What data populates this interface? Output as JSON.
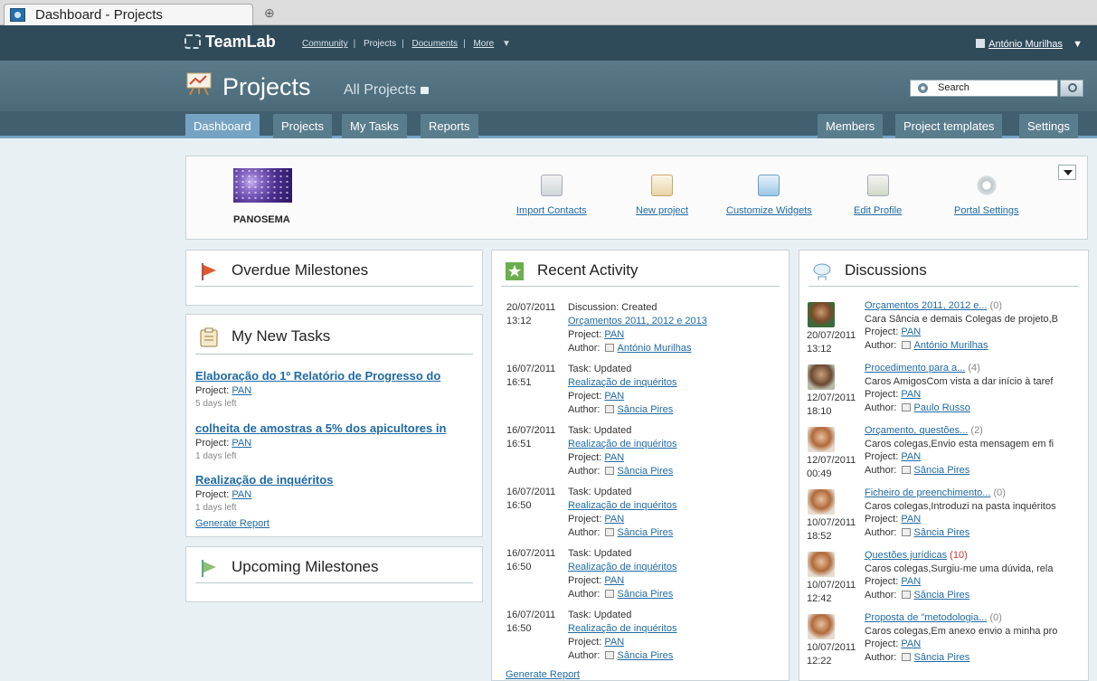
{
  "browser": {
    "tab_title": "Dashboard - Projects",
    "new_tab": "⊕"
  },
  "topbar": {
    "logo": "TeamLab",
    "nav": [
      "Community",
      "Projects",
      "Documents",
      "More"
    ],
    "user": "António Murilhas"
  },
  "module": {
    "title": "Projects",
    "subtitle": "All Projects",
    "search_placeholder": "Search"
  },
  "tabs_left": [
    "Dashboard",
    "Projects",
    "My Tasks",
    "Reports"
  ],
  "tabs_right": [
    "Members",
    "Project templates",
    "Settings"
  ],
  "portal": {
    "name": "PANOSEMA"
  },
  "quick_actions": [
    "Import Contacts",
    "New project",
    "Customize Widgets",
    "Edit Profile",
    "Portal Settings"
  ],
  "widgets": {
    "overdue": {
      "title": "Overdue Milestones"
    },
    "mytasks": {
      "title": "My New Tasks",
      "items": [
        {
          "name": "Elaboração do 1º Relatório de Progresso do",
          "project_label": "Project:",
          "project": "PAN",
          "left": "5 days left"
        },
        {
          "name": "colheita de amostras a 5% dos apicultores in",
          "project_label": "Project:",
          "project": "PAN",
          "left": "1 days left"
        },
        {
          "name": "Realização de inquéritos",
          "project_label": "Project:",
          "project": "PAN",
          "left": "1 days left"
        }
      ],
      "generate": "Generate Report"
    },
    "upcoming": {
      "title": "Upcoming Milestones"
    },
    "recent": {
      "title": "Recent Activity",
      "items": [
        {
          "date": "20/07/2011",
          "time": "13:12",
          "type": "Discussion: Created",
          "link": "Orçamentos 2011, 2012 e 2013",
          "project_label": "Project:",
          "project": "PAN",
          "author_label": "Author:",
          "author": "António Murilhas"
        },
        {
          "date": "16/07/2011",
          "time": "16:51",
          "type": "Task: Updated",
          "link": "Realização de inquéritos",
          "project_label": "Project:",
          "project": "PAN",
          "author_label": "Author:",
          "author": "Sância Pires"
        },
        {
          "date": "16/07/2011",
          "time": "16:51",
          "type": "Task: Updated",
          "link": "Realização de inquéritos",
          "project_label": "Project:",
          "project": "PAN",
          "author_label": "Author:",
          "author": "Sância Pires"
        },
        {
          "date": "16/07/2011",
          "time": "16:50",
          "type": "Task: Updated",
          "link": "Realização de inquéritos",
          "project_label": "Project:",
          "project": "PAN",
          "author_label": "Author:",
          "author": "Sância Pires"
        },
        {
          "date": "16/07/2011",
          "time": "16:50",
          "type": "Task: Updated",
          "link": "Realização de inquéritos",
          "project_label": "Project:",
          "project": "PAN",
          "author_label": "Author:",
          "author": "Sância Pires"
        },
        {
          "date": "16/07/2011",
          "time": "16:50",
          "type": "Task: Updated",
          "link": "Realização de inquéritos",
          "project_label": "Project:",
          "project": "PAN",
          "author_label": "Author:",
          "author": "Sância Pires"
        }
      ],
      "generate": "Generate Report"
    },
    "discussions": {
      "title": "Discussions",
      "items": [
        {
          "title": "Orçamentos 2011, 2012 e...",
          "count": "(0)",
          "excerpt": "Cara Sância e demais Colegas de projeto,B",
          "date": "20/07/2011",
          "time": "13:12",
          "project_label": "Project:",
          "project": "PAN",
          "author_label": "Author:",
          "author": "António Murilhas"
        },
        {
          "title": "Procedimento para a...",
          "count": "(4)",
          "excerpt": "Caros AmigosCom vista a dar início à taref",
          "date": "12/07/2011",
          "time": "18:10",
          "project_label": "Project:",
          "project": "PAN",
          "author_label": "Author:",
          "author": "Paulo Russo"
        },
        {
          "title": "Orçamento, questões...",
          "count": "(2)",
          "excerpt": "Caros colegas,Envio esta mensagem em fi",
          "date": "12/07/2011",
          "time": "00:49",
          "project_label": "Project:",
          "project": "PAN",
          "author_label": "Author:",
          "author": "Sância Pires"
        },
        {
          "title": "Ficheiro de preenchimento...",
          "count": "(0)",
          "excerpt": "Caros colegas,Introduzi na pasta inquéritos",
          "date": "10/07/2011",
          "time": "18:52",
          "project_label": "Project:",
          "project": "PAN",
          "author_label": "Author:",
          "author": "Sância Pires"
        },
        {
          "title": "Questões jurídicas",
          "count": "(10)",
          "excerpt": "Caros colegas,Surgiu-me uma dúvida, rela",
          "date": "10/07/2011",
          "time": "12:42",
          "project_label": "Project:",
          "project": "PAN",
          "author_label": "Author:",
          "author": "Sância Pires"
        },
        {
          "title": "Proposta de \"metodologia...",
          "count": "(0)",
          "excerpt": "Caros colegas,Em anexo envio a minha pro",
          "date": "10/07/2011",
          "time": "12:22",
          "project_label": "Project:",
          "project": "PAN",
          "author_label": "Author:",
          "author": "Sância Pires"
        }
      ]
    }
  },
  "colors": {
    "topbar": "#2f4b5a",
    "active_tab": "#76a3c2",
    "link": "#1f6aa5"
  }
}
